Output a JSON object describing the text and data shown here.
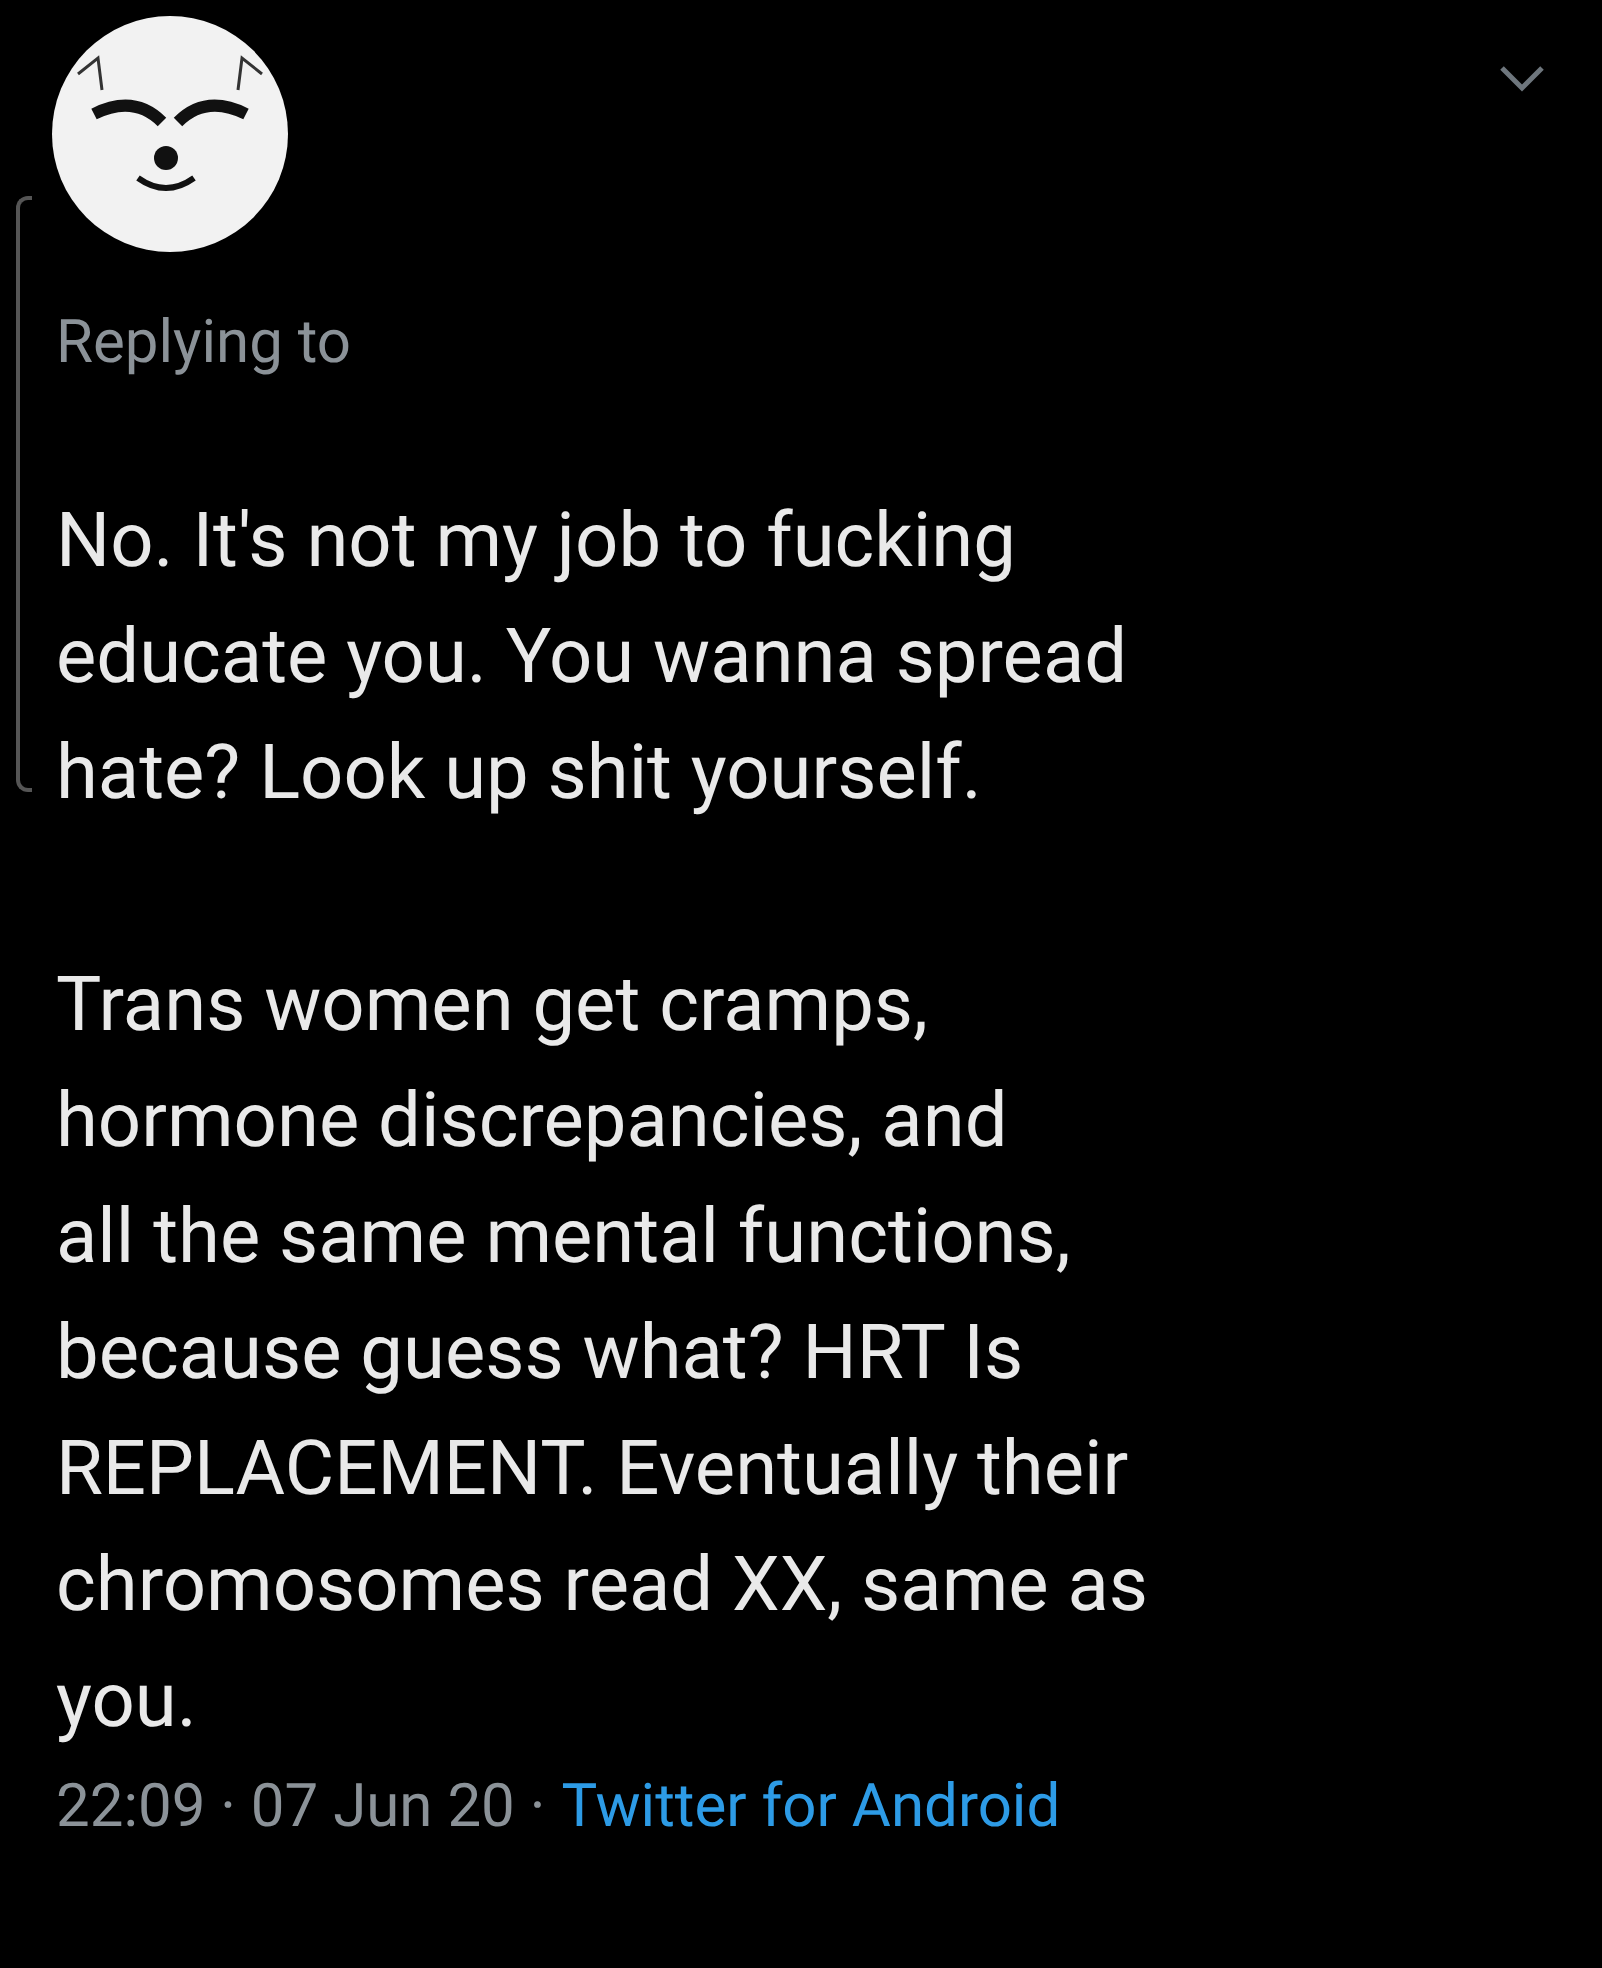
{
  "tweet": {
    "replying_to": "Replying to",
    "paragraphs": [
      "No. It's not my job to fucking\neducate you. You wanna spread\nhate? Look up shit yourself.",
      "Trans women get cramps,\nhormone discrepancies, and\nall the same mental functions,\nbecause guess what? HRT Is\nREPLACEMENT. Eventually their\nchromosomes read XX, same as\nyou."
    ],
    "meta": "22:09 · 07 Jun 20 ·",
    "source": "Twitter for Android"
  }
}
